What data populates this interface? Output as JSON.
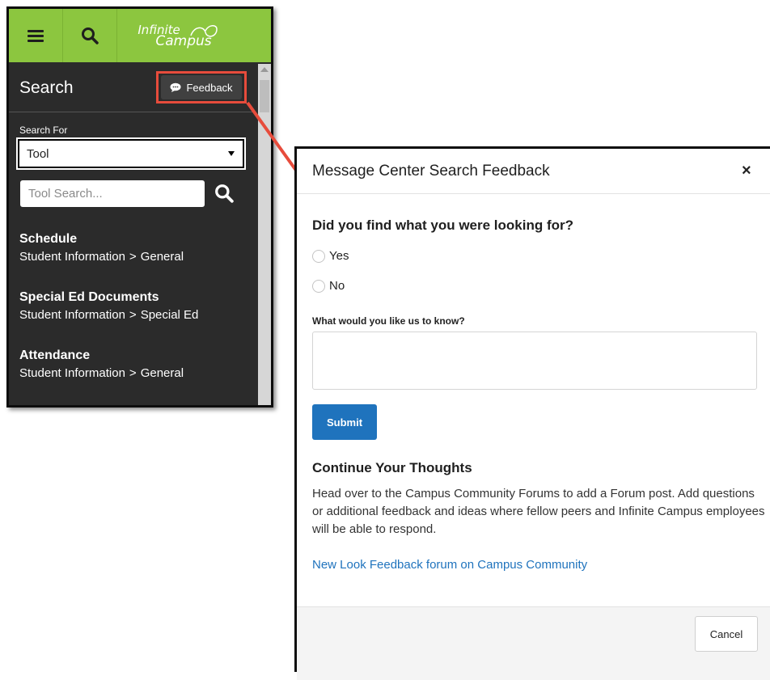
{
  "app": {
    "logo_line1": "Infinite",
    "logo_line2": "Campus"
  },
  "search_panel": {
    "title": "Search",
    "feedback_label": "Feedback",
    "search_for_label": "Search For",
    "search_for_value": "Tool",
    "tool_search_placeholder": "Tool Search...",
    "results": [
      {
        "title": "Schedule",
        "path_1": "Student Information",
        "path_2": "General"
      },
      {
        "title": "Special Ed Documents",
        "path_1": "Student Information",
        "path_2": "Special Ed"
      },
      {
        "title": "Attendance",
        "path_1": "Student Information",
        "path_2": "General"
      }
    ]
  },
  "modal": {
    "title": "Message Center Search Feedback",
    "close_label": "×",
    "question": "Did you find what you were looking for?",
    "option_yes": "Yes",
    "option_no": "No",
    "know_label": "What would you like us to know?",
    "know_value": "",
    "submit_label": "Submit",
    "continue_title": "Continue Your Thoughts",
    "continue_body": "Head over to the Campus Community Forums to add a Forum post. Add questions or additional feedback and ideas where fellow peers and Infinite Campus employees will be able to respond.",
    "forum_link": "New Look Feedback forum on Campus Community",
    "cancel_label": "Cancel"
  },
  "colors": {
    "topbar": "#8cc63f",
    "panel_bg": "#2b2b2b",
    "highlight": "#e74c3c",
    "primary": "#1f73bd"
  },
  "icons": [
    "menu-icon",
    "search-icon",
    "campus-logo",
    "speech-bubble-icon",
    "chevron-down-icon",
    "close-icon",
    "resize-handle-icon"
  ]
}
